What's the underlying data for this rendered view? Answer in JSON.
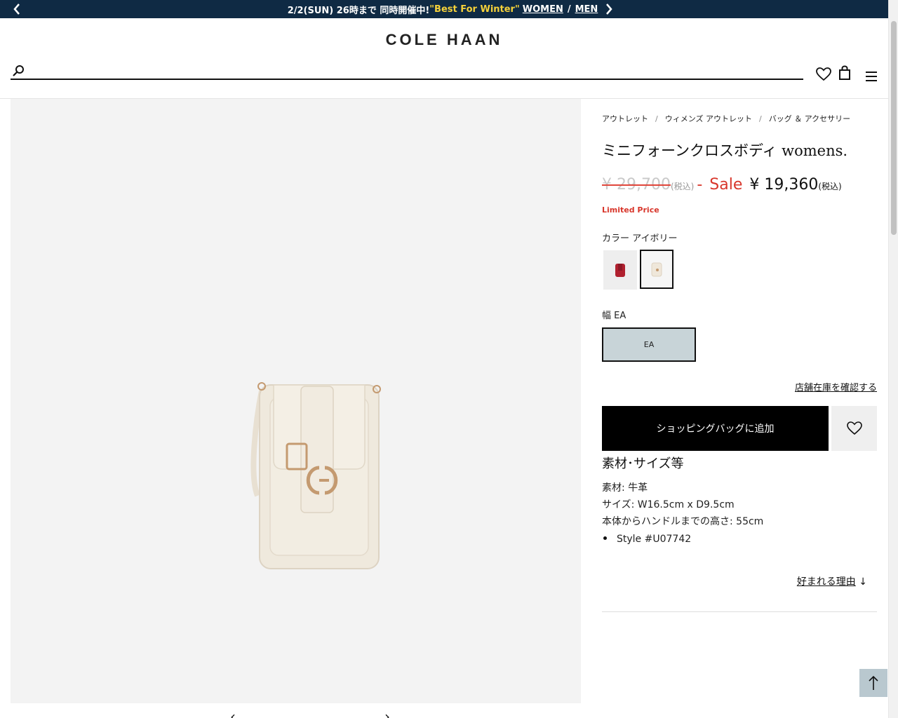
{
  "promo": {
    "text": "2/2(SUN) 26時まで 同時開催中!",
    "highlight": "\"Best For Winter\"",
    "link_women": "WOMEN",
    "separator": "/",
    "link_men": "MEN",
    "color_bg": "#0f2a44",
    "color_highlight": "#f5d13a"
  },
  "header": {
    "logo": "COLE HAAN",
    "search": {
      "placeholder": "",
      "value": ""
    },
    "icons": [
      "search-icon",
      "heart-icon",
      "shopping-bag-icon",
      "menu-icon"
    ]
  },
  "breadcrumb": [
    "アウトレット",
    "ウィメンズ アウトレット",
    "バッグ ＆ アクセサリー"
  ],
  "product": {
    "title": "ミニフォーンクロスボディ womens.",
    "original_price": "¥ 29,700",
    "tax_label": "(税込)",
    "dash": "-",
    "sale_label": "Sale",
    "sale_price": "¥ 19,360",
    "limited": "Limited Price",
    "color_label": "カラー アイボリー",
    "swatches": [
      {
        "name": "red",
        "color": "#b0202f",
        "selected": false
      },
      {
        "name": "ivory",
        "color": "#efe7da",
        "selected": true
      }
    ],
    "width_label": "幅 EA",
    "size_option": "EA",
    "store_stock": "店舗在庫を確認する",
    "add_to_bag": "ショッピングバッグに追加",
    "specs_title": "素材･サイズ等",
    "specs": [
      "素材: 牛革",
      "サイズ: W16.5cm x D9.5cm",
      "本体からハンドルまでの高さ: 55cm"
    ],
    "style": "Style #U07742",
    "why_loved": "好まれる理由",
    "why_arrow": "↓"
  },
  "colors": {
    "sale": "#d8362b",
    "size_selected_bg": "#c8d4d8",
    "gallery_bg": "#f3f3f3"
  }
}
